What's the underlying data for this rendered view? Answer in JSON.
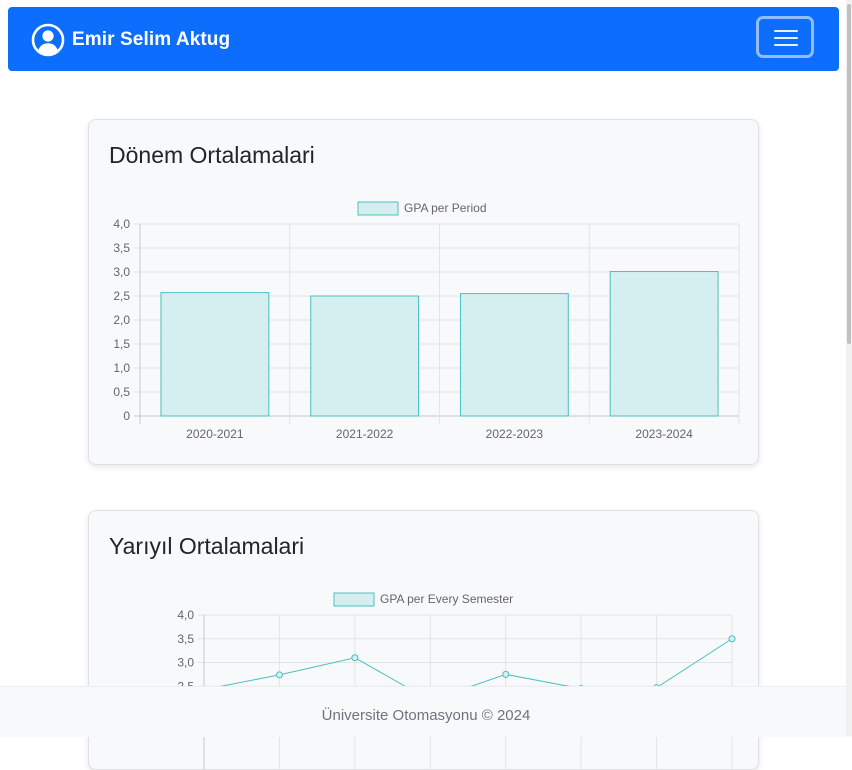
{
  "navbar": {
    "user_name": "Emir Selim Aktug",
    "avatar_icon": "user-circle-icon",
    "toggler_icon": "hamburger-menu-icon",
    "background_color": "#0d6efd"
  },
  "cards": {
    "periods": {
      "title": "Dönem Ortalamalari"
    },
    "semesters": {
      "title": "Yarıyıl Ortalamalari"
    }
  },
  "chart_data": [
    {
      "type": "bar",
      "title": "",
      "categories": [
        "2020-2021",
        "2021-2022",
        "2022-2023",
        "2023-2024"
      ],
      "series": [
        {
          "name": "GPA per Period",
          "values": [
            2.57,
            2.5,
            2.55,
            3.01
          ]
        }
      ],
      "yticks": [
        "0",
        "0,5",
        "1,0",
        "1,5",
        "2,0",
        "2,5",
        "3,0",
        "3,5",
        "4,0"
      ],
      "ylim": [
        0,
        4
      ],
      "grid": true,
      "legend": "top-center",
      "colors": {
        "fill": "#d5eef0",
        "stroke": "#4bc0c0"
      }
    },
    {
      "type": "line",
      "title": "",
      "series": [
        {
          "name": "GPA per Every Semester",
          "values": [
            2.43,
            2.74,
            3.1,
            2.2,
            2.75,
            2.45,
            2.47,
            3.5
          ]
        }
      ],
      "yticks": [
        "2,5",
        "3,0",
        "3,5",
        "4,0"
      ],
      "ylim": [
        0,
        4
      ],
      "grid": true,
      "legend": "top-center",
      "colors": {
        "fill": "#d5eef0",
        "stroke": "#4bc0c0"
      }
    }
  ],
  "footer": {
    "text": "Üniversite Otomasyonu © 2024"
  }
}
